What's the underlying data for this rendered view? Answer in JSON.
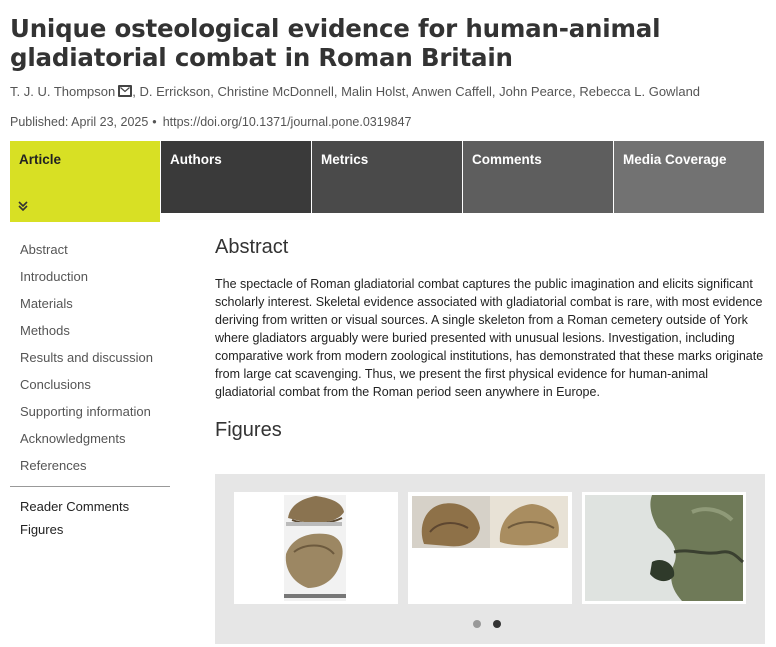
{
  "article": {
    "title": "Unique osteological evidence for human-animal gladiatorial combat in Roman Britain",
    "authors": [
      "T. J. U. Thompson",
      "D. Errickson",
      "Christine McDonnell",
      "Malin Holst",
      "Anwen Caffell",
      "John Pearce",
      "Rebecca L. Gowland"
    ],
    "published": "Published: April 23, 2025",
    "dot": "•",
    "doi": "https://doi.org/10.1371/journal.pone.0319847"
  },
  "tabs": [
    {
      "label": "Article",
      "active": true,
      "color": "#d8e024"
    },
    {
      "label": "Authors",
      "color": "#3a3a3a"
    },
    {
      "label": "Metrics",
      "color": "#4a4a4a"
    },
    {
      "label": "Comments",
      "color": "#5e5e5e"
    },
    {
      "label": "Media Coverage",
      "color": "#727272"
    }
  ],
  "tab_chevron": "»",
  "sidenav": {
    "links": [
      "Abstract",
      "Introduction",
      "Materials",
      "Methods",
      "Results and discussion",
      "Conclusions",
      "Supporting information",
      "Acknowledgments",
      "References"
    ],
    "extra": [
      "Reader Comments",
      "Figures"
    ]
  },
  "main": {
    "abstract_heading": "Abstract",
    "abstract_text": "The spectacle of Roman gladiatorial combat captures the public imagination and elicits significant scholarly interest. Skeletal evidence associated with gladiatorial combat is rare, with most evidence deriving from written or visual sources. A single skeleton from a Roman cemetery outside of York where gladiators arguably were buried presented with unusual lesions. Investigation, including comparative work from modern zoological institutions, has demonstrated that these marks originate from large cat scavenging. Thus, we present the first physical evidence for human-animal gladiatorial combat from the Roman period seen anywhere in Europe.",
    "figures_heading": "Figures"
  },
  "carousel": {
    "active_index": 1,
    "dot_colors": [
      "#999999",
      "#333333"
    ]
  }
}
